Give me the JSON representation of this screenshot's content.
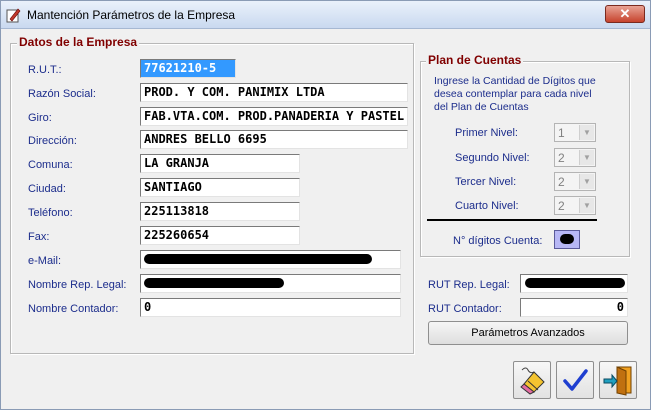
{
  "window": {
    "title": "Mantención Parámetros de la Empresa",
    "close_glyph": "✕"
  },
  "empresa": {
    "title": "Datos de la Empresa",
    "rut_label": "R.U.T.:",
    "rut_value": "77621210-5",
    "razon_label": "Razón Social:",
    "razon_value": "PROD. Y COM. PANIMIX LTDA",
    "giro_label": "Giro:",
    "giro_value": "FAB.VTA.COM. PROD.PANADERIA Y PASTEL",
    "direccion_label": "Dirección:",
    "direccion_value": "ANDRES BELLO 6695",
    "comuna_label": "Comuna:",
    "comuna_value": "LA GRANJA",
    "ciudad_label": "Ciudad:",
    "ciudad_value": "SANTIAGO",
    "telefono_label": "Teléfono:",
    "telefono_value": "225113818",
    "fax_label": "Fax:",
    "fax_value": "225260654",
    "email_label": "e-Mail:",
    "rep_label": "Nombre Rep. Legal:",
    "contador_label": "Nombre Contador:",
    "contador_value": "0",
    "rut_rep_label": "RUT Rep. Legal:",
    "rut_contador_label": "RUT Contador:",
    "rut_contador_value": "0"
  },
  "plan": {
    "title": "Plan de Cuentas",
    "info": "Ingrese la Cantidad de Dígitos que desea contemplar para cada nivel del Plan de Cuentas",
    "niveles": [
      {
        "label": "Primer Nivel:",
        "value": "1"
      },
      {
        "label": "Segundo Nivel:",
        "value": "2"
      },
      {
        "label": "Tercer Nivel:",
        "value": "2"
      },
      {
        "label": "Cuarto Nivel:",
        "value": "2"
      }
    ],
    "digitos_label": "N° dígitos Cuenta:"
  },
  "buttons": {
    "avanzados": "Parámetros Avanzados"
  },
  "icons": {
    "app": "edit-form-icon",
    "clear": "eraser-icon",
    "accept": "checkmark-icon",
    "exit": "exit-door-icon"
  },
  "colors": {
    "label": "#1c2d8c",
    "group_title": "#800000",
    "selection": "#3399ff"
  }
}
